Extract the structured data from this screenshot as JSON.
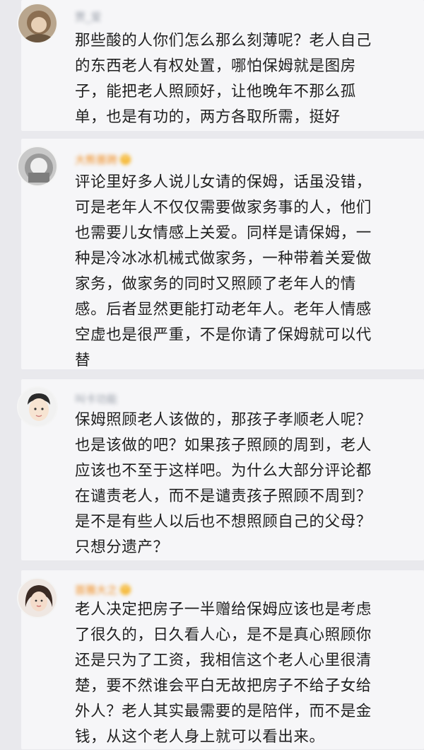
{
  "comments": [
    {
      "username": "贾_爱",
      "has_vip_badge": false,
      "lines": [
        "那些酸的人你们怎么那么刻薄呢？老人自己",
        "的东西老人有权处置，哪怕保姆就是图房",
        "子，能把老人照顾好，让他晚年不那么孤",
        "单，也是有功的，两方各取所需，挺好"
      ]
    },
    {
      "username": "大熊普跨",
      "has_vip_badge": true,
      "lines": [
        "评论里好多人说儿女请的保姆，话虽没错，",
        "可是老年人不仅仅需要做家务事的人，他们",
        "也需要儿女情感上关爱。同样是请保姆，一",
        "种是冷冰冰机械式做家务，一种带着关爱做",
        "家务，做家务的同时又照顾了老年人的情",
        "感。后者显然更能打动老年人。老年人情感",
        "空虚也是很严重，不是你请了保姆就可以代",
        "替"
      ]
    },
    {
      "username": "叫卡功能",
      "has_vip_badge": false,
      "lines": [
        "保姆照顾老人该做的，那孩子孝顺老人呢？",
        "也是该做的吧？如果孩子照顾的周到，老人",
        "应该也不至于这样吧。为什么大部分评论都",
        "在谴责老人，而不是谴责孩子照顾不周到？",
        "是不是有些人以后也不想照顾自己的父母？",
        "只想分遗产？"
      ]
    },
    {
      "username": "首雅大之",
      "has_vip_badge": true,
      "lines": [
        "老人决定把房子一半赠给保姆应该也是考虑",
        "了很久的，日久看人心，是不是真心照顾你",
        "还是只为了工资，我相信这个老人心里很清",
        "楚，要不然谁会平白无故把房子不给子女给",
        "外人？老人其实最需要的是陪伴，而不是金",
        "钱，从这个老人身上就可以看出来。"
      ]
    }
  ]
}
